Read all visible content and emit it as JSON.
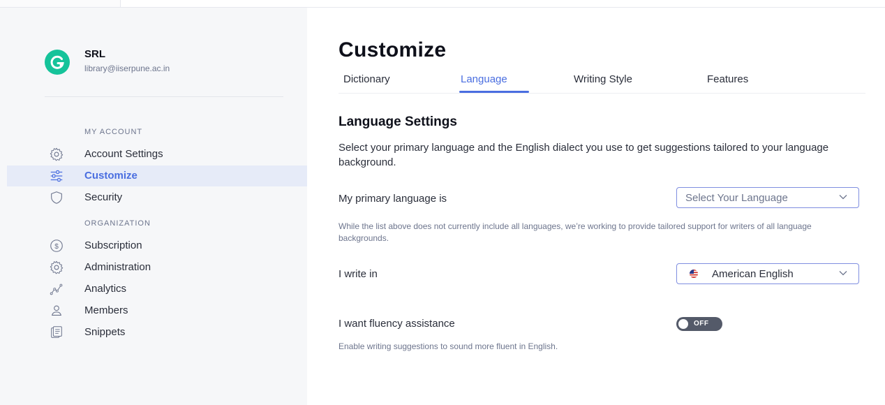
{
  "profile": {
    "initial": "G",
    "name": "SRL",
    "email": "library@iiserpune.ac.in"
  },
  "sidebar": {
    "my_account_label": "MY ACCOUNT",
    "organization_label": "ORGANIZATION",
    "items": [
      {
        "label": "Account Settings",
        "icon": "gear-icon"
      },
      {
        "label": "Customize",
        "icon": "sliders-icon",
        "active": true
      },
      {
        "label": "Security",
        "icon": "shield-icon"
      },
      {
        "label": "Subscription",
        "icon": "dollar-icon"
      },
      {
        "label": "Administration",
        "icon": "gear-icon"
      },
      {
        "label": "Analytics",
        "icon": "analytics-icon"
      },
      {
        "label": "Members",
        "icon": "person-icon"
      },
      {
        "label": "Snippets",
        "icon": "snippets-icon"
      }
    ]
  },
  "main": {
    "title": "Customize",
    "tabs": [
      {
        "label": "Dictionary"
      },
      {
        "label": "Language",
        "active": true
      },
      {
        "label": "Writing Style"
      },
      {
        "label": "Features"
      }
    ],
    "section_title": "Language Settings",
    "description": "Select your primary language and the English dialect you use to get suggestions tailored to your language background.",
    "primary_language": {
      "label": "My primary language is",
      "placeholder": "Select Your Language",
      "hint": "While the list above does not currently include all languages, we’re working to provide tailored support for writers of all language backgrounds."
    },
    "write_in": {
      "label": "I write in",
      "value": "American English"
    },
    "fluency": {
      "label": "I want fluency assistance",
      "toggle_text": "OFF",
      "hint": "Enable writing suggestions to sound more fluent in English."
    }
  },
  "colors": {
    "accent": "#4a6ee0",
    "brand": "#15c39a",
    "active_bg": "#e6ebf8",
    "toggle_off": "#545a69"
  }
}
